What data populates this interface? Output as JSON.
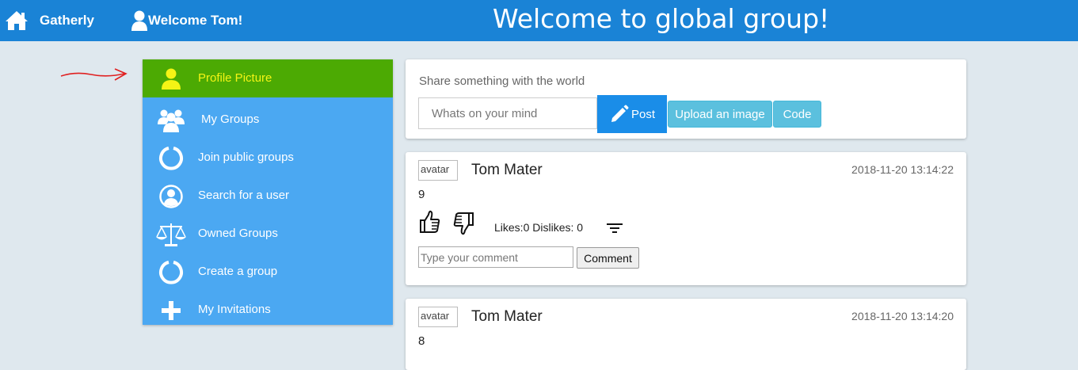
{
  "header": {
    "brand": "Gatherly",
    "welcome": "Welcome Tom!",
    "title": "Welcome to global group!"
  },
  "sidebar": {
    "items": [
      {
        "label": "Profile Picture",
        "icon": "person-icon"
      },
      {
        "label": "My Groups",
        "icon": "group-icon"
      },
      {
        "label": "Join public groups",
        "icon": "ring-icon"
      },
      {
        "label": "Search for a user",
        "icon": "user-circle-icon"
      },
      {
        "label": "Owned Groups",
        "icon": "scale-icon"
      },
      {
        "label": "Create a group",
        "icon": "ring-icon"
      },
      {
        "label": "My Invitations",
        "icon": "plus-icon"
      }
    ]
  },
  "share": {
    "label": "Share something with the world",
    "placeholder": "Whats on your mind",
    "post_label": "Post",
    "upload_label": "Upload an image",
    "code_label": "Code"
  },
  "posts": [
    {
      "avatar_alt": "avatar",
      "author": "Tom Mater",
      "timestamp": "2018-11-20 13:14:22",
      "body": "9",
      "counts": "Likes:0 Dislikes: 0",
      "comment_placeholder": "Type your comment",
      "comment_label": "Comment"
    },
    {
      "avatar_alt": "avatar",
      "author": "Tom Mater",
      "timestamp": "2018-11-20 13:14:20",
      "body": "8"
    }
  ],
  "colors": {
    "topbar": "#1a83d6",
    "sidebar": "#4ba8f2",
    "highlight": "#4faa01",
    "active_text": "#f4f415",
    "post_button": "#1a8de8",
    "info_button": "#5bc0de",
    "page_bg": "#dfe8ee"
  }
}
